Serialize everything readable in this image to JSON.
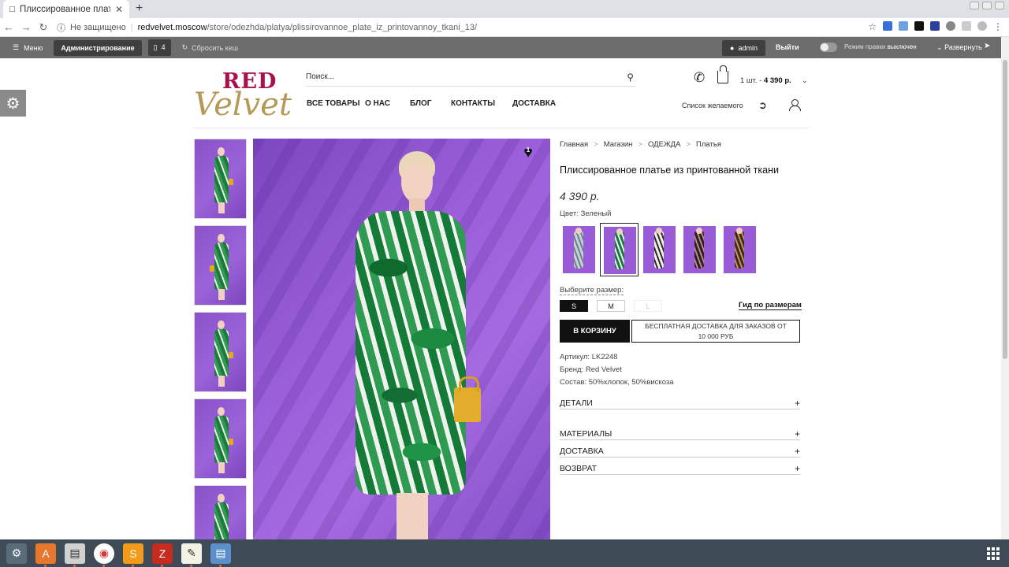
{
  "browser": {
    "tab_title": "Плиссированное платье",
    "url_security": "Не защищено",
    "url_host": "redvelvet.moscow",
    "url_path": "/store/odezhda/platya/plissirovannoe_plate_iz_printovannoy_tkani_13/"
  },
  "adminbar": {
    "menu_label": "Меню",
    "admin_label": "Администрирование",
    "count": "4",
    "cache_label": "Сбросить кеш",
    "user_label": "admin",
    "logout_label": "Выйти",
    "edit_mode_label": "Режим правки",
    "edit_mode_state": "выключен",
    "expand_label": "Развернуть"
  },
  "header": {
    "logo_top": "RED",
    "logo_bottom": "Velvet",
    "search_placeholder": "Поиск...",
    "nav": [
      "ВСЕ ТОВАРЫ",
      "О НАС",
      "БЛОГ",
      "КОНТАКТЫ",
      "ДОСТАВКА"
    ],
    "cart_count": "1 шт. -",
    "cart_total": "4 390 р.",
    "wishlist_label": "Список желаемого"
  },
  "gallery": {
    "favorites_count": "1"
  },
  "product": {
    "breadcrumb": [
      "Главная",
      "Магазин",
      "ОДЕЖДА",
      "Платья"
    ],
    "title": "Плиссированное платье из принтованной ткани",
    "price": "4 390 р.",
    "color_label": "Цвет: Зеленый",
    "size_label": "Выберите размер:",
    "sizes": [
      "S",
      "M",
      "L"
    ],
    "size_guide": "Гид по размерам",
    "add_to_cart": "В КОРЗИНУ",
    "free_shipping": "БЕСПЛАТНАЯ ДОСТАВКА ДЛЯ ЗАКАЗОВ ОТ 10 000 РУБ",
    "sku": "Артикул: LK2248",
    "brand": "Бренд: Red Velvet",
    "composition": "Состав: 50%хлопок, 50%вискоза",
    "accordion": [
      "ДЕТАЛИ",
      "МАТЕРИАЛЫ",
      "ДОСТАВКА",
      "ВОЗВРАТ"
    ]
  },
  "colors": {
    "brand_red": "#a8124a",
    "brand_gold": "#b59a57",
    "admin_bar": "#6c6c6c",
    "taskbar": "#3e4a55"
  }
}
